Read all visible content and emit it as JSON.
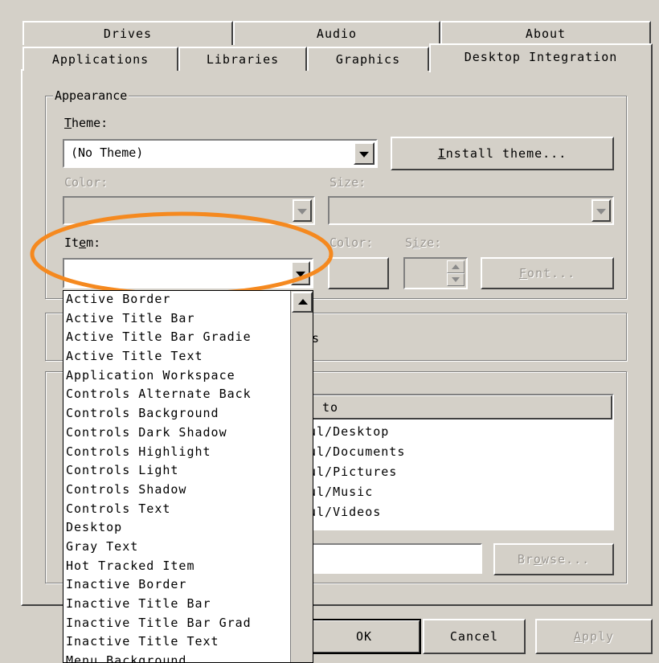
{
  "tabs_row1": [
    "Drives",
    "Audio",
    "About"
  ],
  "tabs_row2": [
    "Applications",
    "Libraries",
    "Graphics",
    "Desktop Integration"
  ],
  "appearance": {
    "legend": "Appearance",
    "theme_label": "Theme:",
    "theme_value": "(No Theme)",
    "install_button": "Install theme...",
    "color_label": "Color:",
    "size_label": "Size:",
    "item_label": "Item:",
    "item_color_label": "Color:",
    "item_size_label": "Size:",
    "font_button": "Font...",
    "item_value": ""
  },
  "item_list": [
    "Active Border",
    "Active Title Bar",
    "Active Title Bar Gradie",
    "Active Title Text",
    "Application Workspace",
    "Controls Alternate Back",
    "Controls Background",
    "Controls Dark Shadow",
    "Controls Highlight",
    "Controls Light",
    "Controls Shadow",
    "Controls Text",
    "Desktop",
    "Gray Text",
    "Hot Tracked Item",
    "Inactive Border",
    "Inactive Title Bar",
    "Inactive Title Bar Grad",
    "Inactive Title Text",
    "Menu Background"
  ],
  "partial_texts": {
    "mid_s": "s",
    "link_header": "to",
    "paths": [
      "ul/Desktop",
      "ul/Documents",
      "ul/Pictures",
      "ul/Music",
      "ul/Videos"
    ]
  },
  "browse_button": "Browse...",
  "footer": {
    "ok": "OK",
    "cancel": "Cancel",
    "apply": "Apply"
  },
  "colors": {
    "face": "#d4d0c8",
    "highlight_ellipse": "#f5891f"
  }
}
